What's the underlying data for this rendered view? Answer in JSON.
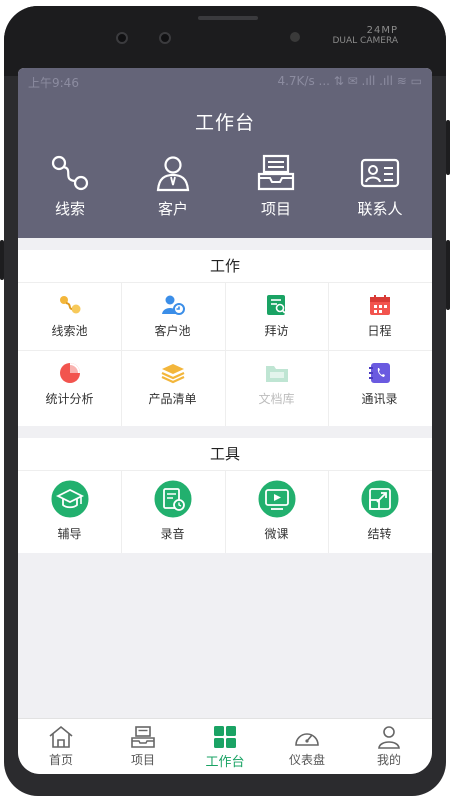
{
  "device": {
    "camera_label_1": "24MP",
    "camera_label_2": "DUAL CAMERA"
  },
  "status_bar": {
    "time": "上午9:46",
    "network": "4.7K/s ... ⇅ ✉ .ıll .ıll ≋ ▭"
  },
  "header": {
    "title": "工作台",
    "quick_actions": [
      {
        "label": "线索",
        "icon": "clue-icon"
      },
      {
        "label": "客户",
        "icon": "customer-icon"
      },
      {
        "label": "项目",
        "icon": "project-icon"
      },
      {
        "label": "联系人",
        "icon": "contact-card-icon"
      }
    ]
  },
  "work": {
    "title": "工作",
    "items": [
      {
        "label": "线索池",
        "icon": "clue-pool-icon",
        "color": "#f3b63b",
        "disabled": false
      },
      {
        "label": "客户池",
        "icon": "customer-pool-icon",
        "color": "#3b8ee8",
        "disabled": false
      },
      {
        "label": "拜访",
        "icon": "visit-icon",
        "color": "#1aa364",
        "disabled": false
      },
      {
        "label": "日程",
        "icon": "calendar-icon",
        "color": "#f2544e",
        "disabled": false
      },
      {
        "label": "统计分析",
        "icon": "pie-chart-icon",
        "color": "#f2544e",
        "disabled": false
      },
      {
        "label": "产品清单",
        "icon": "layers-icon",
        "color": "#f3b63b",
        "disabled": false
      },
      {
        "label": "文档库",
        "icon": "folder-icon",
        "color": "#bfe5d3",
        "disabled": true
      },
      {
        "label": "通讯录",
        "icon": "phone-book-icon",
        "color": "#6a5ae0",
        "disabled": false
      }
    ]
  },
  "tools": {
    "title": "工具",
    "items": [
      {
        "label": "辅导",
        "icon": "graduation-cap-icon"
      },
      {
        "label": "录音",
        "icon": "recording-icon"
      },
      {
        "label": "微课",
        "icon": "video-play-icon"
      },
      {
        "label": "结转",
        "icon": "transfer-icon"
      }
    ],
    "accent": "#22b06e"
  },
  "tabbar": {
    "tabs": [
      {
        "label": "首页",
        "icon": "home-icon",
        "active": false
      },
      {
        "label": "项目",
        "icon": "project-icon",
        "active": false
      },
      {
        "label": "工作台",
        "icon": "grid-icon",
        "active": true
      },
      {
        "label": "仪表盘",
        "icon": "dashboard-icon",
        "active": false
      },
      {
        "label": "我的",
        "icon": "profile-icon",
        "active": false
      }
    ],
    "active_color": "#1aa364"
  },
  "colors": {
    "header_bg": "#646478",
    "page_bg": "#f0f0f3"
  }
}
